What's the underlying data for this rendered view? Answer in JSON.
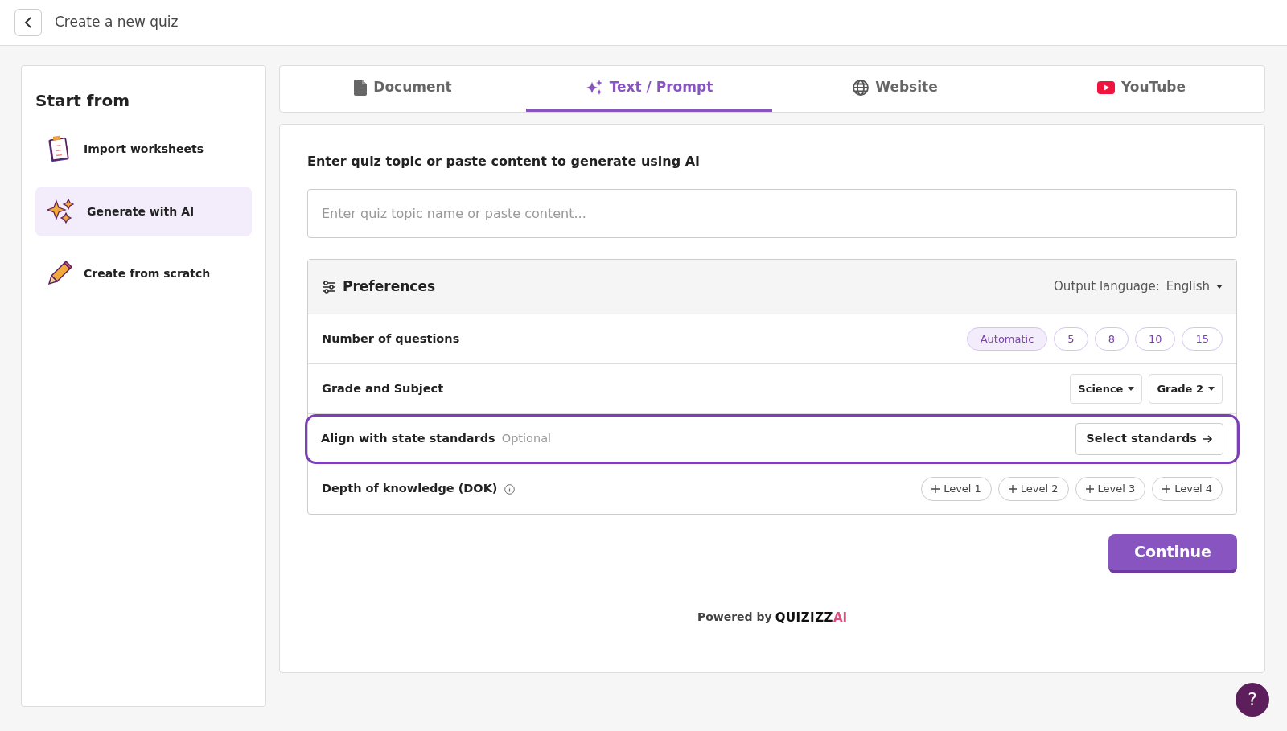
{
  "header": {
    "title": "Create a new quiz"
  },
  "sidebar": {
    "title": "Start from",
    "items": [
      {
        "label": "Import worksheets",
        "kind": "clipboard",
        "selected": false
      },
      {
        "label": "Generate with AI",
        "kind": "sparkles",
        "selected": true
      },
      {
        "label": "Create from scratch",
        "kind": "pencil",
        "selected": false
      }
    ]
  },
  "tabs": [
    {
      "label": "Document",
      "kind": "document",
      "selected": false
    },
    {
      "label": "Text / Prompt",
      "kind": "sparkles",
      "selected": true
    },
    {
      "label": "Website",
      "kind": "globe",
      "selected": false
    },
    {
      "label": "YouTube",
      "kind": "youtube",
      "selected": false
    }
  ],
  "prompt": {
    "heading": "Enter quiz topic or paste content to generate using AI",
    "placeholder": "Enter quiz topic name or paste content..."
  },
  "preferences": {
    "title": "Preferences",
    "output_language_label": "Output language:",
    "output_language": "English",
    "rows": [
      {
        "kind": "chips",
        "label": "Number of questions",
        "highlighted": false,
        "options": [
          {
            "label": "Automatic",
            "selected": true
          },
          {
            "label": "5",
            "selected": false
          },
          {
            "label": "8",
            "selected": false
          },
          {
            "label": "10",
            "selected": false
          },
          {
            "label": "15",
            "selected": false
          }
        ]
      },
      {
        "kind": "dropdowns",
        "label": "Grade and Subject",
        "highlighted": false,
        "dropdowns": [
          "Science",
          "Grade 2"
        ]
      },
      {
        "kind": "action",
        "label": "Align with state standards",
        "note": "Optional",
        "highlighted": true,
        "button": "Select standards"
      },
      {
        "kind": "levels",
        "label": "Depth of knowledge (DOK)",
        "highlighted": false,
        "info": true,
        "levels": [
          "Level 1",
          "Level 2",
          "Level 3",
          "Level 4"
        ]
      }
    ]
  },
  "continue_button": "Continue",
  "footer": {
    "powered_by": "Powered by",
    "logo": "QUIZIZZ",
    "logo_suffix": "AI"
  },
  "help_button": "?"
}
